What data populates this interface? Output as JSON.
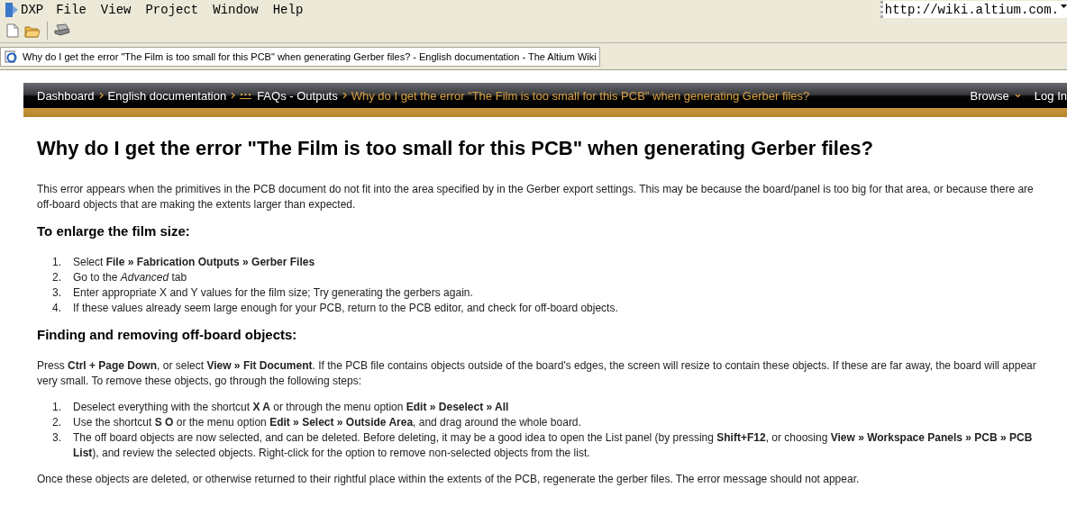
{
  "menu_bar": {
    "items": [
      {
        "label": "DXP"
      },
      {
        "label": "File"
      },
      {
        "label": "View"
      },
      {
        "label": "Project"
      },
      {
        "label": "Window"
      },
      {
        "label": "Help"
      }
    ]
  },
  "address_field": {
    "value": "http://wiki.altium.com."
  },
  "document_tab": {
    "title": "Why do I get the error \"The Film is too small for this PCB\" when generating Gerber files? - English documentation - The Altium Wiki"
  },
  "breadcrumb": [
    {
      "label": "Dashboard",
      "kind": "link"
    },
    {
      "label": "English documentation",
      "kind": "link"
    },
    {
      "label": "FAQs - Outputs",
      "kind": "grouped-link"
    },
    {
      "label": "Why do I get the error \"The Film is too small for this PCB\" when generating Gerber files?",
      "kind": "current"
    }
  ],
  "nav_links": [
    {
      "label": "Browse",
      "has_menu": true
    },
    {
      "label": "Log In",
      "has_menu": false
    }
  ],
  "article": {
    "title": "Why do I get the error \"The Film is too small for this PCB\" when generating Gerber files?",
    "blocks": [
      {
        "kind": "paragraph",
        "text": "This error appears when the primitives in the PCB document do not fit into the area specified by in the Gerber export settings. This may be because the board/panel is too big for that area, or because there are off-board objects that are making the extents larger than expected."
      },
      {
        "kind": "heading",
        "text": "To enlarge the film size:"
      },
      {
        "kind": "list",
        "items": [
          {
            "number": "1.",
            "text": "Select **File » Fabrication Outputs » Gerber Files**"
          },
          {
            "number": "2.",
            "text": "Go to the *Advanced* tab"
          },
          {
            "number": "3.",
            "text": "Enter appropriate X and Y values for the film size; Try generating the gerbers again."
          },
          {
            "number": "4.",
            "text": "If these values already seem large enough for your PCB, return to the PCB editor, and check for off-board objects."
          }
        ]
      },
      {
        "kind": "heading",
        "text": "Finding and removing off-board objects:"
      },
      {
        "kind": "paragraph",
        "text": "Press **Ctrl + Page Down**, or select **View » Fit Document**. If the PCB file contains objects outside of the board's edges, the screen will resize to contain these objects. If these are far away, the board will appear very small. To remove these objects, go through the following steps:"
      },
      {
        "kind": "list",
        "items": [
          {
            "number": "1.",
            "text": "Deselect everything with the shortcut **X A** or through the menu option **Edit » Deselect » All**"
          },
          {
            "number": "2.",
            "text": "Use the shortcut **S O** or the menu option **Edit » Select » Outside Area**, and drag around the whole board."
          },
          {
            "number": "3.",
            "text": "The off board objects are now selected, and can be deleted. Before deleting, it may be a good idea to open the List panel (by pressing **Shift+F12**, or choosing **View » Workspace Panels » PCB » PCB List**), and review the selected objects. Right-click for the option to remove non-selected objects from the list."
          }
        ]
      },
      {
        "kind": "paragraph",
        "text": "Once these objects are deleted, or otherwise returned to their rightful place within the extents of the PCB, regenerate the gerber files. The error message should not appear."
      }
    ]
  }
}
